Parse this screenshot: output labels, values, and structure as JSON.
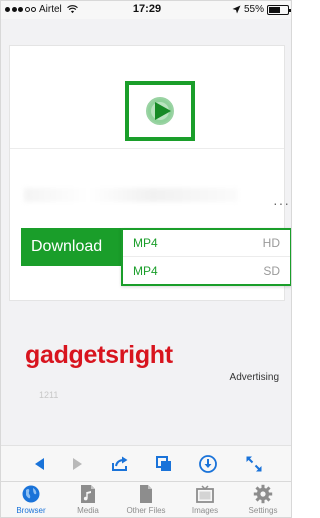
{
  "status_bar": {
    "carrier": "Airtel",
    "time": "17:29",
    "battery": "55%",
    "icons": [
      "signal-dots",
      "wifi-icon",
      "location-arrow-icon",
      "battery-icon"
    ]
  },
  "media_card": {
    "thumbnail_icon": "video-play-icon",
    "download_label": "Download",
    "more_icon": "more-dots-icon"
  },
  "format_menu": {
    "options": [
      {
        "format": "MP4",
        "quality": "HD"
      },
      {
        "format": "MP4",
        "quality": "SD"
      }
    ]
  },
  "watermark": "gadgetsright",
  "ad": {
    "label": "Advertising",
    "number": "1211"
  },
  "toolbar": {
    "icons": [
      "back-arrow-icon",
      "forward-arrow-icon",
      "share-icon",
      "copy-icon",
      "download-icon",
      "fullscreen-icon"
    ]
  },
  "tabbar": {
    "active": "Browser",
    "tabs": [
      {
        "label": "Browser",
        "icon": "globe-icon"
      },
      {
        "label": "Media",
        "icon": "music-file-icon"
      },
      {
        "label": "Other Files",
        "icon": "file-icon"
      },
      {
        "label": "Images",
        "icon": "images-icon"
      },
      {
        "label": "Settings",
        "icon": "gear-icon"
      }
    ]
  },
  "colors": {
    "accent_green": "#1a9e2a",
    "link_blue": "#1a73d9",
    "watermark_red": "#d8141e"
  }
}
